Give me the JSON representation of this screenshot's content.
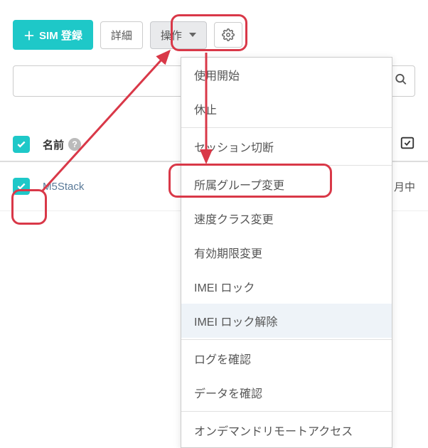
{
  "toolbar": {
    "register_label": "SIM 登録",
    "details_label": "詳細",
    "actions_label": "操作"
  },
  "search": {
    "value": ""
  },
  "table": {
    "header_name": "名前",
    "rows": [
      {
        "name": "M5Stack",
        "status": "月中"
      }
    ]
  },
  "dropdown": {
    "items": [
      {
        "label": "使用開始"
      },
      {
        "label": "休止"
      },
      {
        "divider": true
      },
      {
        "label": "セッション切断"
      },
      {
        "divider": true
      },
      {
        "label": "所属グループ変更"
      },
      {
        "label": "速度クラス変更"
      },
      {
        "label": "有効期限変更"
      },
      {
        "label": "IMEI ロック"
      },
      {
        "label": "IMEI ロック解除",
        "hovered": true
      },
      {
        "divider": true
      },
      {
        "label": "ログを確認"
      },
      {
        "label": "データを確認"
      },
      {
        "divider": true
      },
      {
        "label": "オンデマンドリモートアクセス"
      }
    ]
  }
}
